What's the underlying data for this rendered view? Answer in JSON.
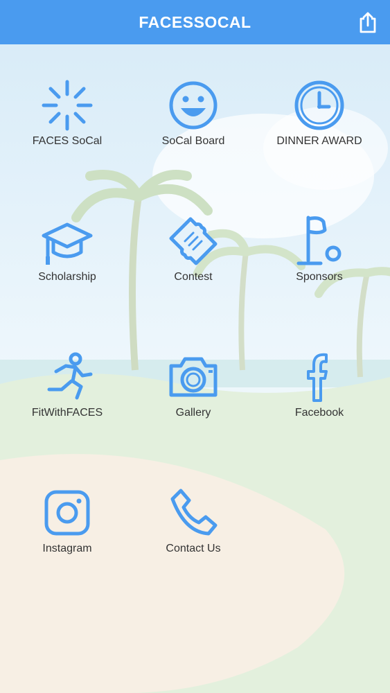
{
  "header": {
    "title": "FACESSOCAL",
    "share_icon": "share-icon"
  },
  "theme": {
    "accent": "#4a9bef",
    "header_bg": "#4a9bef",
    "label_color": "#333333"
  },
  "tiles": [
    {
      "label": "FACES SoCal",
      "icon": "sunburst-icon"
    },
    {
      "label": "SoCal Board",
      "icon": "smiley-icon"
    },
    {
      "label": "DINNER AWARD",
      "icon": "clock-icon"
    },
    {
      "label": "Scholarship",
      "icon": "graduation-cap-icon"
    },
    {
      "label": "Contest",
      "icon": "ticket-icon"
    },
    {
      "label": "Sponsors",
      "icon": "golf-flag-icon"
    },
    {
      "label": "FitWithFACES",
      "icon": "running-person-icon"
    },
    {
      "label": "Gallery",
      "icon": "camera-icon"
    },
    {
      "label": "Facebook",
      "icon": "facebook-icon"
    },
    {
      "label": "Instagram",
      "icon": "instagram-icon"
    },
    {
      "label": "Contact Us",
      "icon": "phone-icon"
    }
  ]
}
